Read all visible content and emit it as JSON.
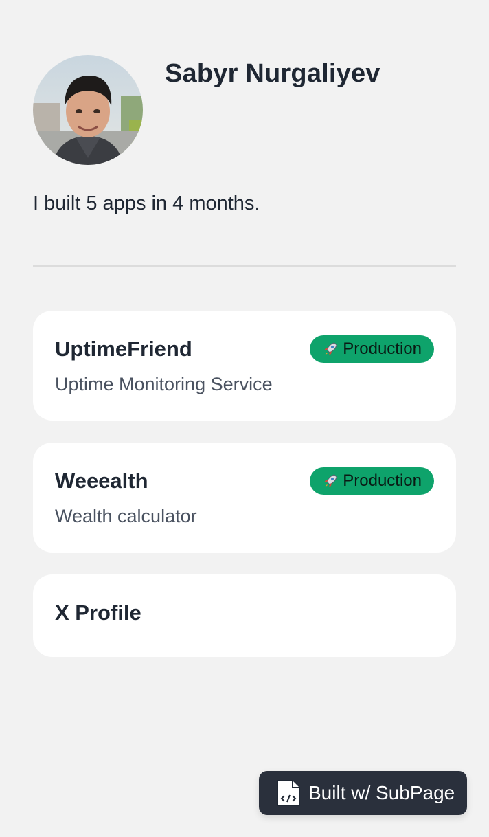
{
  "profile": {
    "name": "Sabyr Nurgaliyev",
    "bio": "I built 5 apps in 4 months.",
    "avatar_icon": "avatar-photo"
  },
  "cards": [
    {
      "title": "UptimeFriend",
      "description": "Uptime Monitoring Service",
      "badge": "Production",
      "badge_icon": "rocket-icon"
    },
    {
      "title": "Weeealth",
      "description": "Wealth calculator",
      "badge": "Production",
      "badge_icon": "rocket-icon"
    },
    {
      "title": "X Profile"
    }
  ],
  "footer": {
    "built_with_label": "Built w/ SubPage",
    "icon": "code-file-icon"
  },
  "colors": {
    "background": "#f2f2f2",
    "card": "#ffffff",
    "badge": "#0ea36b",
    "text": "#1f2733",
    "footer_button": "#2a303c"
  }
}
